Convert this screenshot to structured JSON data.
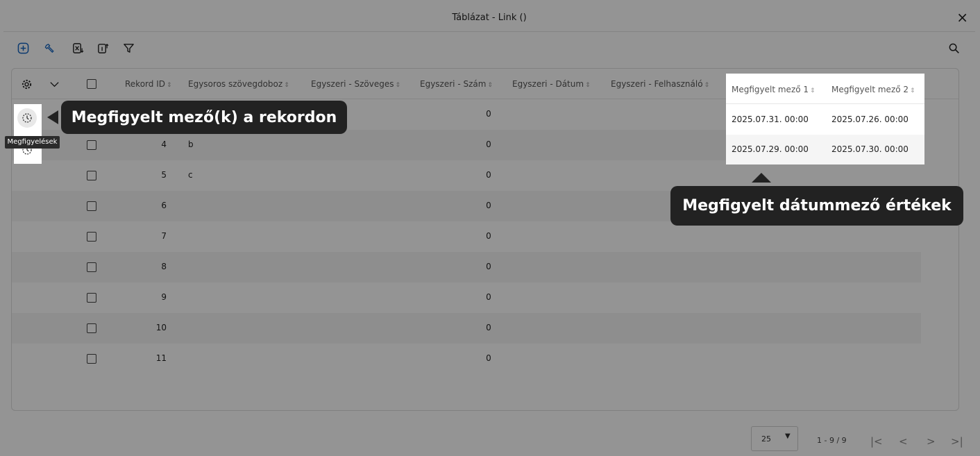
{
  "window": {
    "title": "Táblázat - Link ()",
    "close_glyph": "×"
  },
  "toolbar": {
    "icons": [
      "add-icon",
      "wrench-icon",
      "excel-export-icon",
      "import-icon",
      "filter-icon",
      "search-icon"
    ],
    "accent": "#1565c0"
  },
  "table": {
    "columns": [
      "Rekord ID",
      "Egysoros szövegdoboz",
      "Egyszeri - Szöveges",
      "Egyszeri - Szám",
      "Egyszeri - Dátum",
      "Egyszeri - Felhasználó",
      "Megfigyelt mező 1",
      "Megfigyelt mező 2"
    ],
    "sort_glyph": "⇕",
    "rows": [
      {
        "id": "",
        "text": "",
        "num": "0",
        "watched1": "2025.07.31. 00:00",
        "watched2": "2025.07.26. 00:00"
      },
      {
        "id": "4",
        "text": "b",
        "num": "0",
        "watched1": "2025.07.29. 00:00",
        "watched2": "2025.07.30. 00:00"
      },
      {
        "id": "5",
        "text": "c",
        "num": "0",
        "watched1": "",
        "watched2": ""
      },
      {
        "id": "6",
        "text": "",
        "num": "0",
        "watched1": "",
        "watched2": ""
      },
      {
        "id": "7",
        "text": "",
        "num": "0",
        "watched1": "",
        "watched2": ""
      },
      {
        "id": "8",
        "text": "",
        "num": "0",
        "watched1": "",
        "watched2": ""
      },
      {
        "id": "9",
        "text": "",
        "num": "0",
        "watched1": "",
        "watched2": ""
      },
      {
        "id": "10",
        "text": "",
        "num": "0",
        "watched1": "",
        "watched2": ""
      },
      {
        "id": "11",
        "text": "",
        "num": "0",
        "watched1": "",
        "watched2": ""
      }
    ]
  },
  "tooltip": {
    "watch": "Megfigyelések"
  },
  "callouts": {
    "watch_icon": "Megfigyelt mező(k) a rekordon",
    "watched_values": "Megfigyelt dátummező értékek"
  },
  "pagination": {
    "page_size": "25",
    "range": "1 - 9 / 9",
    "first": "|<",
    "prev": "<",
    "next": ">",
    "last": ">|"
  }
}
